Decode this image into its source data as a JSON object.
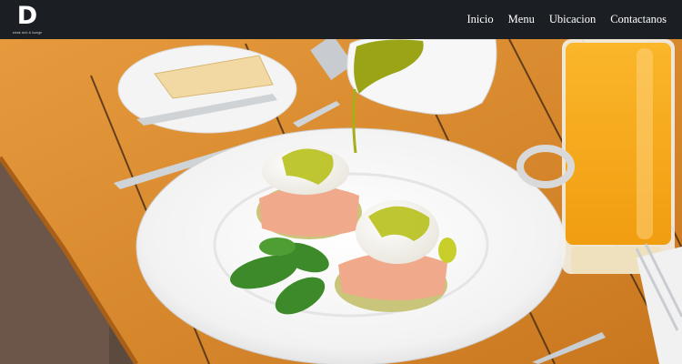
{
  "header": {
    "logo_letter": "D",
    "logo_tagline": "steak club & lounge",
    "nav": [
      {
        "label": "Inicio"
      },
      {
        "label": "Menu"
      },
      {
        "label": "Ubicacion"
      },
      {
        "label": "Contactanos"
      }
    ]
  },
  "hero": {
    "description_icon": "breakfast-photo"
  },
  "colors": {
    "header_bg": "#1b1f24",
    "nav_text": "#ffffff",
    "table_wood": "#d8892e",
    "orange_juice": "#f6a318",
    "pesto_sauce": "#b9c11f"
  }
}
